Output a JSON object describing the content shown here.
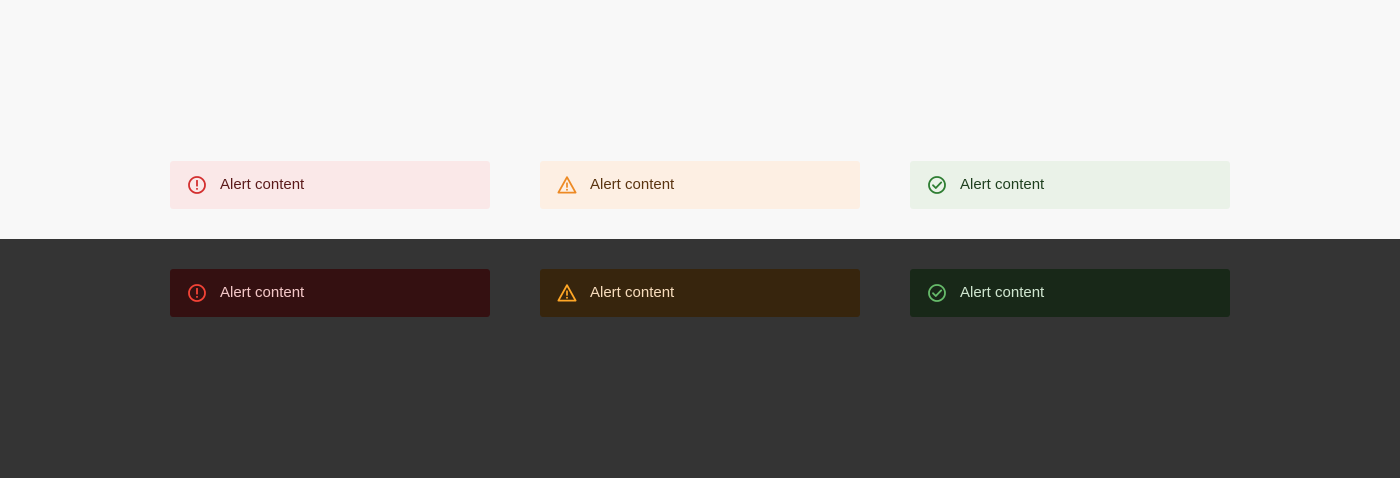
{
  "light": {
    "error": {
      "icon": "error-outline-icon",
      "text": "Alert content",
      "background": "#fae8e8",
      "accent": "#d32f2f"
    },
    "warning": {
      "icon": "warning-triangle-icon",
      "text": "Alert content",
      "background": "#fdefe3",
      "accent": "#ed8a24"
    },
    "success": {
      "icon": "check-circle-icon",
      "text": "Alert content",
      "background": "#eaf2e8",
      "accent": "#2e7d32"
    }
  },
  "dark": {
    "error": {
      "icon": "error-outline-icon",
      "text": "Alert content",
      "background": "#341011",
      "accent": "#f44336"
    },
    "warning": {
      "icon": "warning-triangle-icon",
      "text": "Alert content",
      "background": "#37250d",
      "accent": "#ffa726"
    },
    "success": {
      "icon": "check-circle-icon",
      "text": "Alert content",
      "background": "#182818",
      "accent": "#66bb6a"
    }
  },
  "colors": {
    "light_surface": "#f8f8f8",
    "dark_surface": "#343434"
  }
}
